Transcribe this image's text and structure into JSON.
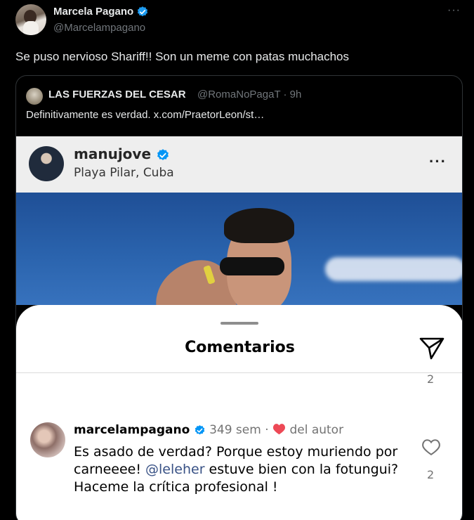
{
  "tweet": {
    "author_name": "Marcela Pagano",
    "author_handle": "@Marcelampagano",
    "more_label": "···",
    "text": "Se puso nervioso Shariff!! Son un meme con patas muchachos"
  },
  "quote": {
    "author_name": "LAS FUERZAS DEL CESAR",
    "meta": "@RomaNoPagaT · 9h",
    "text": "Definitivamente es verdad.  x.com/PraetorLeon/st…"
  },
  "instagram": {
    "username": "manujove",
    "location": "Playa Pilar, Cuba",
    "more_label": "···",
    "sheet_title": "Comentarios",
    "top_count": "2",
    "comment": {
      "username": "marcelampagano",
      "age": "349 sem",
      "separator": "·",
      "author_like": "del autor",
      "text_before": "Es asado de verdad? Porque estoy muriendo por carneeee! ",
      "mention": "@leleher",
      "text_after": " estuve bien con la fotungui? Haceme la crítica profesional !",
      "like_count": "2"
    }
  },
  "colors": {
    "background": "#000000",
    "verified_blue": "#1d9bf0",
    "ig_verified_blue": "#0095f6",
    "heart_red": "#ed4956",
    "mention": "#385185"
  },
  "icons": [
    "verified-badge-icon",
    "more-icon",
    "send-icon",
    "heart-icon"
  ]
}
